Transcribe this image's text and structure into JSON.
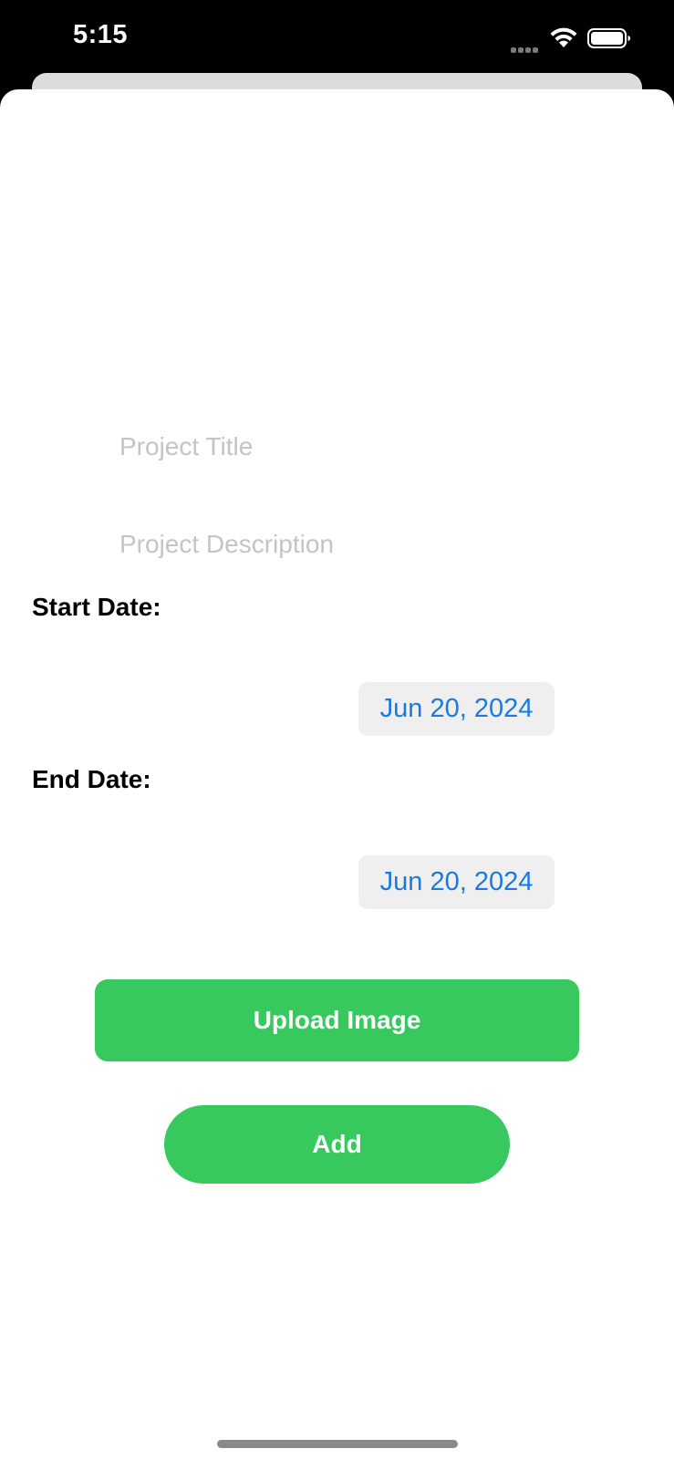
{
  "status_bar": {
    "time": "5:15",
    "icons": [
      "cellular-signal-icon",
      "wifi-icon",
      "battery-icon"
    ]
  },
  "form": {
    "title_placeholder": "Project Title",
    "title_value": "",
    "description_placeholder": "Project Description",
    "description_value": "",
    "start_label": "Start Date:",
    "start_date": "Jun 20, 2024",
    "end_label": "End Date:",
    "end_date": "Jun 20, 2024"
  },
  "actions": {
    "upload_label": "Upload Image",
    "add_label": "Add"
  },
  "colors": {
    "accent_green": "#37c95d",
    "date_text_blue": "#1a7ae0",
    "date_pill_bg": "#efeff0",
    "placeholder_gray": "#c4c4c6"
  }
}
